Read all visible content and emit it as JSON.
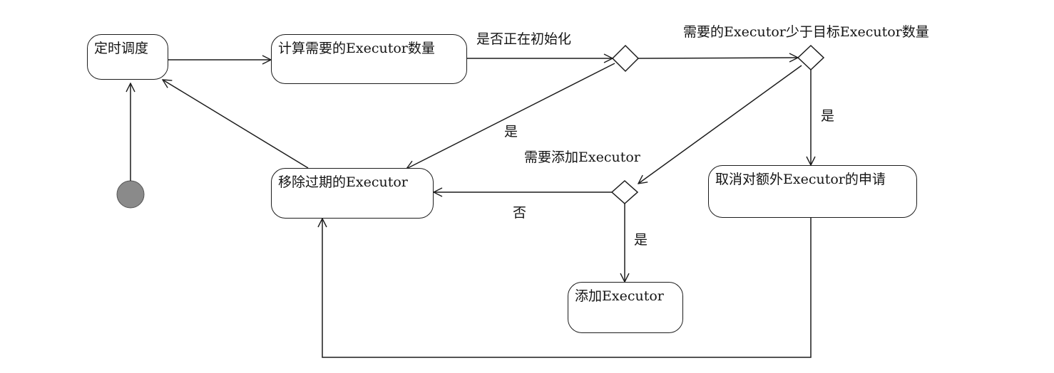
{
  "states": {
    "timer": "定时调度",
    "compute": "计算需要的Executor数量",
    "remove": "移除过期的Executor",
    "add": "添加Executor",
    "cancel": "取消对额外Executor的申请"
  },
  "guards": {
    "initializing": "是否正在初始化",
    "need_less": "需要的Executor少于目标Executor数量",
    "init_yes": "是",
    "need_add": "需要添加Executor",
    "less_yes": "是",
    "add_no": "否",
    "add_yes": "是"
  },
  "colors": {
    "stroke": "#1c1c1c",
    "initial_fill": "#8a8a8a"
  }
}
